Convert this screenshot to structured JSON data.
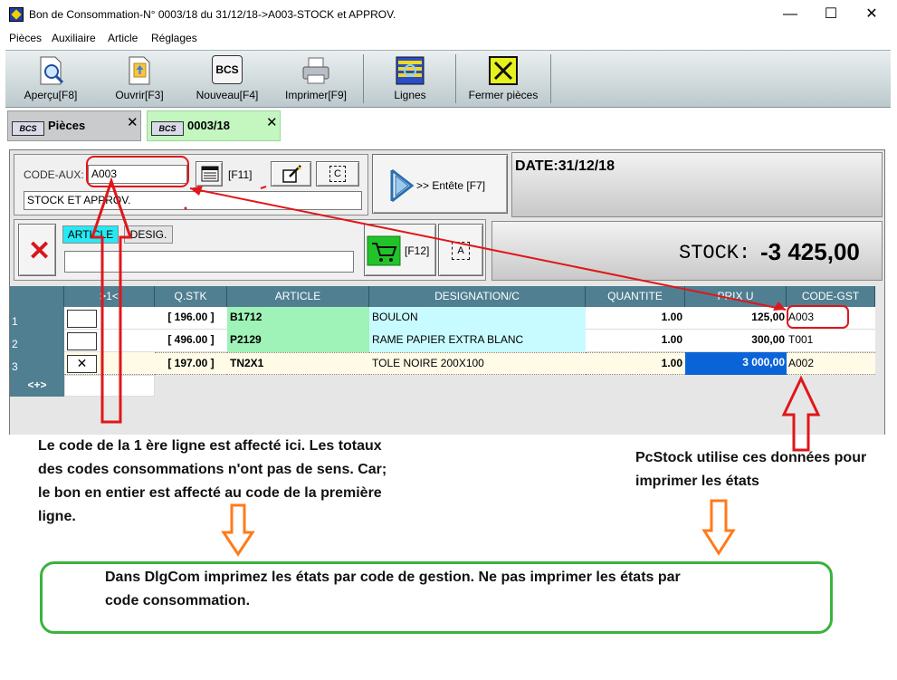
{
  "window": {
    "title": "Bon de Consommation-N° 0003/18 du 31/12/18->A003-STOCK et APPROV.",
    "minimize": "—",
    "maximize": "☐",
    "close": "✕"
  },
  "menu": [
    "Pièces",
    "Auxiliaire",
    "Article",
    "Réglages"
  ],
  "toolbar": {
    "apercu": "Aperçu[F8]",
    "ouvrir": "Ouvrir[F3]",
    "nouveau": "Nouveau[F4]",
    "nouveau_icon_text": "BCS",
    "imprimer": "Imprimer[F9]",
    "lignes": "Lignes",
    "fermer": "Fermer pièces"
  },
  "tabs": [
    {
      "icon_text": "BCS",
      "label": "Pièces",
      "close": "✕"
    },
    {
      "icon_text": "BCS",
      "label": "0003/18",
      "close": "✕"
    }
  ],
  "header": {
    "code_aux_label": "CODE-AUX:",
    "code_aux_value": "A003",
    "aux_name": "STOCK ET APPROV.",
    "f11": "[F11]",
    "c_icon_text": "C",
    "entete": ">> Entête [F7]",
    "date": "DATE:31/12/18"
  },
  "article_bar": {
    "tab_article": "ARTICLE",
    "tab_desig": "DESIG.",
    "search_value": "",
    "f12": "[F12]",
    "a_icon_text": "A",
    "stock_label": "STOCK:",
    "stock_value": "-3 425,00"
  },
  "grid": {
    "columns": [
      "",
      ">1<",
      "Q.STK",
      "ARTICLE",
      "DESIGNATION/C",
      "QUANTITE",
      "PRIX U",
      "CODE-GST"
    ],
    "rows": [
      {
        "num": "1",
        "qstk": "[ 196.00 ]",
        "article": "B1712",
        "designation": "BOULON",
        "quantite": "1.00",
        "prix": "125,00",
        "code_gst": "A003"
      },
      {
        "num": "2",
        "qstk": "[ 496.00 ]",
        "article": "P2129",
        "designation": "RAME PAPIER EXTRA BLANC",
        "quantite": "1.00",
        "prix": "300,00",
        "code_gst": "T001"
      },
      {
        "num": "3",
        "qstk": "[ 197.00 ]",
        "article": "TN2X1",
        "designation": "TOLE NOIRE 200X100",
        "quantite": "1.00",
        "prix": "3 000,00",
        "code_gst": "A002"
      }
    ],
    "footer_label": "<+>"
  },
  "annotations": {
    "left_note": [
      "Le code de la 1 ère ligne est affecté ici. Les totaux",
      "des codes consommations n'ont pas de sens. Car;",
      "le bon en entier est affecté au code de la première",
      "ligne."
    ],
    "right_note": [
      "PcStock utilise ces données pour",
      "imprimer les états"
    ],
    "box_note": [
      "Dans DlgCom imprimez les états par code de gestion. Ne pas imprimer les états par",
      "code consommation."
    ]
  },
  "colors": {
    "header_blue": "#4f7f91",
    "article_green": "#9ff2b8",
    "designation_cyan": "#c8fbff",
    "selected_blue": "#0a64d8",
    "annotation_red": "#e0161b",
    "annotation_orange": "#ff7a1a",
    "annotation_green": "#3bb33b"
  }
}
